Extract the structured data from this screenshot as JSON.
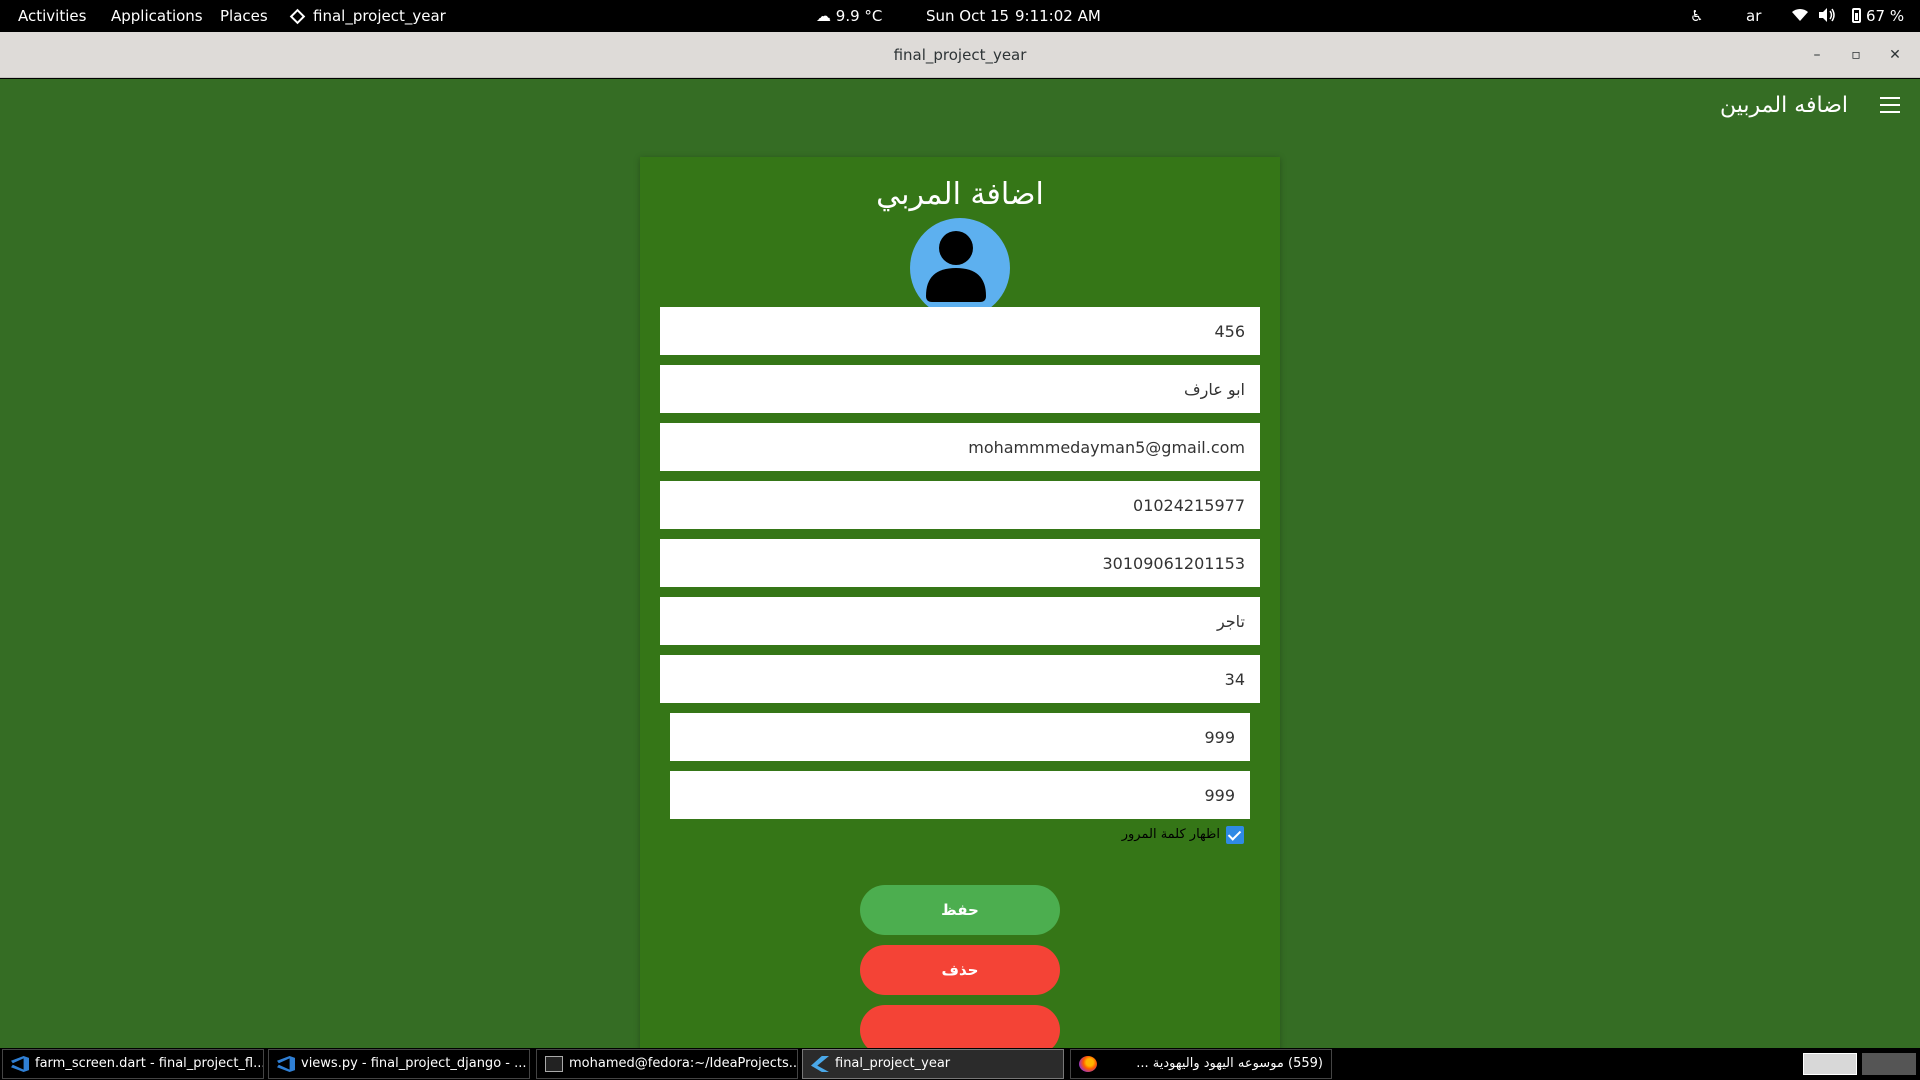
{
  "topbar": {
    "activities": "Activities",
    "applications": "Applications",
    "places": "Places",
    "app_name": "final_project_year",
    "weather": "9.9 °C",
    "date": "Sun Oct 15",
    "time": "9:11:02 AM",
    "lang": "ar",
    "battery": "67 %"
  },
  "window": {
    "title": "final_project_year",
    "min_symbol": "–",
    "max_symbol": "▫",
    "close_symbol": "✕"
  },
  "appbar": {
    "title": "اضافه المربين"
  },
  "form": {
    "title": "اضافة المربي",
    "fields": [
      {
        "value": "456"
      },
      {
        "value": "ابو عارف"
      },
      {
        "value": "mohammmedayman5@gmail.com"
      },
      {
        "value": "01024215977"
      },
      {
        "value": "30109061201153"
      },
      {
        "value": "تاجر"
      },
      {
        "value": "34"
      },
      {
        "value": "999"
      },
      {
        "value": "999"
      }
    ],
    "show_password_label": "اظهار كلمة المرور",
    "show_password_checked": true,
    "save_label": "حفظ",
    "delete_label": "حذف"
  },
  "taskbar": {
    "items": [
      {
        "label": "farm_screen.dart - final_project_fl...",
        "icon": "vscode-icon"
      },
      {
        "label": "views.py - final_project_django - ...",
        "icon": "vscode-icon"
      },
      {
        "label": "mohamed@fedora:~/IdeaProjects...",
        "icon": "terminal-icon"
      },
      {
        "label": "final_project_year",
        "icon": "flutter-icon"
      },
      {
        "label": "(559) موسوعه اليهود واليهودية ...",
        "icon": "firefox-icon"
      }
    ]
  },
  "colors": {
    "app_background": "#356d24",
    "card_background": "#357617",
    "avatar_background": "#5db0ef",
    "save_button": "#4cae4f",
    "delete_button": "#f44336",
    "checkbox": "#2f8ae5"
  }
}
